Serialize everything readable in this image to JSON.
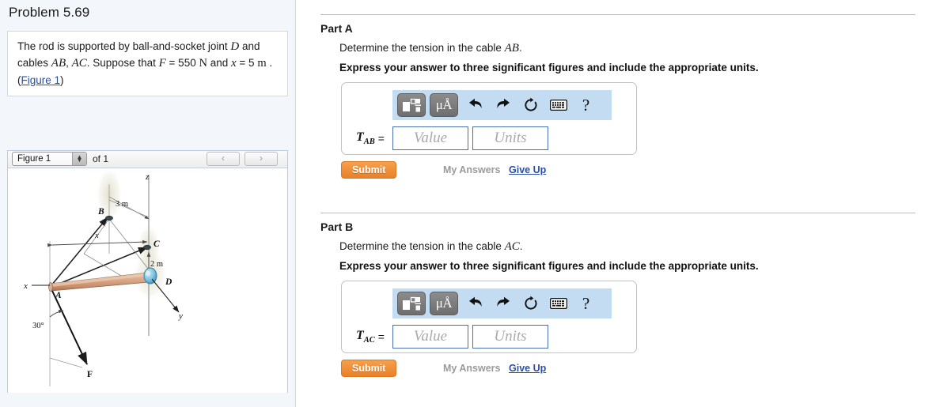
{
  "sidebar": {
    "problem_title": "Problem 5.69",
    "statement": {
      "seg1": "The rod is supported by ball-and-socket joint ",
      "joint": "D",
      "seg2": " and cables ",
      "cable1": "AB",
      "comma": ", ",
      "cable2": "AC",
      "seg3": ". Suppose that ",
      "force_sym": "F",
      "seg4": " = 550 ",
      "force_unit": "N",
      "seg5": " and ",
      "dist_sym": "x",
      "seg6": " = 5 ",
      "dist_unit": "m",
      "seg7": " . (",
      "figure_link": "Figure 1",
      "seg8": ")"
    },
    "figure_nav": {
      "selected_figure": "Figure 1",
      "of_label": "of 1",
      "prev_icon": "‹",
      "next_icon": "›",
      "stepper_up": "▲",
      "stepper_down": "▼"
    },
    "figure": {
      "labels": {
        "point_b": "B",
        "point_c": "C",
        "point_d": "D",
        "point_a": "A",
        "axis_z": "z",
        "axis_y": "y",
        "axis_x_left": "x",
        "dim_x": "x",
        "dim_3m": "3 m",
        "dim_2m": "2 m",
        "angle": "30°",
        "force": "F"
      },
      "colors": {
        "rod_light": "#dcab8e",
        "rod_mid": "#c98f6c",
        "rod_dark": "#a87350",
        "joint_blue": "#7fc4e0",
        "joint_blue_dark": "#3f8fb5",
        "node_dark": "#3a4a52",
        "glow": "#e4e2cf"
      }
    }
  },
  "parts": [
    {
      "id": "a",
      "title": "Part A",
      "question_prefix": "Determine the tension in the cable ",
      "question_symbol": "AB",
      "question_suffix": ".",
      "instruction": "Express your answer to three significant figures and include the appropriate units.",
      "answer": {
        "label_base": "T",
        "label_sub": "AB",
        "equals": "=",
        "value_placeholder": "Value",
        "units_placeholder": "Units",
        "value": "",
        "units": ""
      },
      "toolbar": {
        "template_icon": "math-template-icon",
        "units_label": "μÅ",
        "undo_icon": "undo-arrow",
        "redo_icon": "redo-arrow",
        "reset_icon": "reset-circle",
        "keyboard_icon": "keyboard",
        "help_label": "?"
      },
      "submit_label": "Submit",
      "my_answers_label": "My Answers",
      "give_up_label": "Give Up"
    },
    {
      "id": "b",
      "title": "Part B",
      "question_prefix": "Determine the tension in the cable ",
      "question_symbol": "AC",
      "question_suffix": ".",
      "instruction": "Express your answer to three significant figures and include the appropriate units.",
      "answer": {
        "label_base": "T",
        "label_sub": "AC",
        "equals": "=",
        "value_placeholder": "Value",
        "units_placeholder": "Units",
        "value": "",
        "units": ""
      },
      "toolbar": {
        "template_icon": "math-template-icon",
        "units_label": "μÅ",
        "undo_icon": "undo-arrow",
        "redo_icon": "redo-arrow",
        "reset_icon": "reset-circle",
        "keyboard_icon": "keyboard",
        "help_label": "?"
      },
      "submit_label": "Submit",
      "my_answers_label": "My Answers",
      "give_up_label": "Give Up"
    }
  ],
  "theme": {
    "sidebar_bg": "#f3f7fc",
    "toolbar_blue": "#c3dcf2",
    "submit_orange": "#e8812a",
    "link_blue": "#2a4fa2",
    "input_border": "#4a6fb5",
    "muted_grey": "#9a9a9a"
  }
}
